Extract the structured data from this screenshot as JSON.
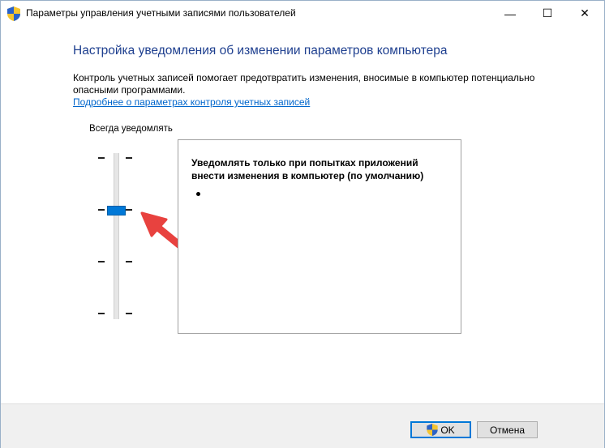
{
  "window": {
    "title": "Параметры управления учетными записями пользователей",
    "minimize_glyph": "—",
    "maximize_glyph": "☐",
    "close_glyph": "✕"
  },
  "heading": "Настройка уведомления об изменении параметров компьютера",
  "description": "Контроль учетных записей помогает предотвратить изменения, вносимые в компьютер потенциально опасными программами.",
  "learn_more_link": "Подробнее о параметрах контроля учетных записей",
  "slider": {
    "top_label": "Всегда уведомлять",
    "levels": 4,
    "selected_level": 3
  },
  "info": {
    "title": "Уведомлять только при попытках приложений внести изменения в компьютер (по умолчанию)"
  },
  "buttons": {
    "ok": "OK",
    "cancel": "Отмена"
  },
  "icons": {
    "title": "uac-shield-icon",
    "ok": "uac-shield-icon"
  },
  "colors": {
    "heading": "#1e3f8f",
    "link": "#0066cc",
    "thumb": "#0078d7",
    "arrow": "#e8423f"
  }
}
